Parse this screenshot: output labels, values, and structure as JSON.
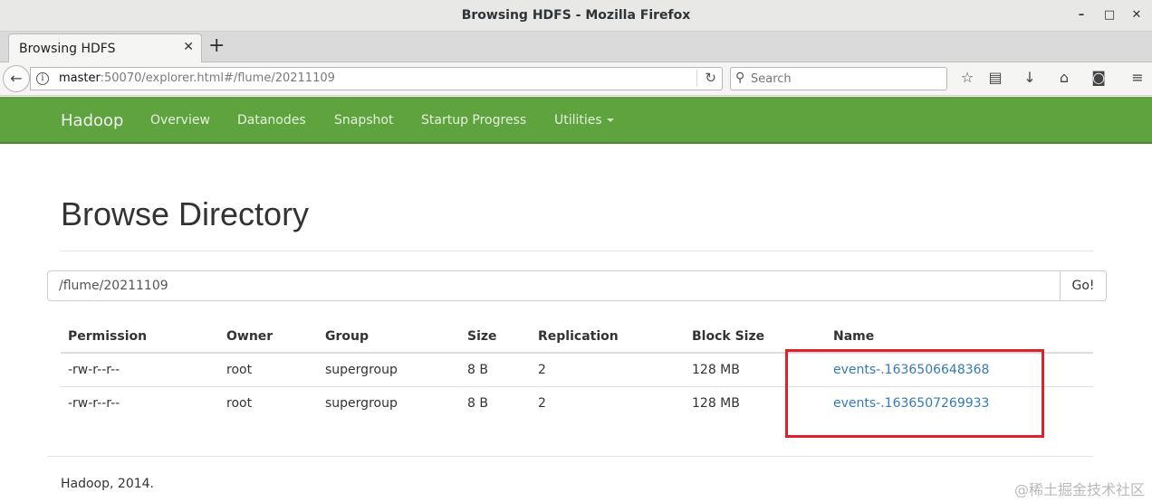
{
  "window": {
    "title": "Browsing HDFS - Mozilla Firefox"
  },
  "tabs": [
    {
      "label": "Browsing HDFS"
    }
  ],
  "address": {
    "host": "master",
    "path": ":50070/explorer.html#/flume/20211109"
  },
  "search": {
    "placeholder": "Search"
  },
  "hadoop_nav": {
    "brand": "Hadoop",
    "items": [
      "Overview",
      "Datanodes",
      "Snapshot",
      "Startup Progress",
      "Utilities"
    ]
  },
  "page": {
    "title": "Browse Directory",
    "path_value": "/flume/20211109",
    "go_label": "Go!"
  },
  "table": {
    "headers": [
      "Permission",
      "Owner",
      "Group",
      "Size",
      "Replication",
      "Block Size",
      "Name"
    ],
    "rows": [
      [
        "-rw-r--r--",
        "root",
        "supergroup",
        "8 B",
        "2",
        "128 MB",
        "events-.1636506648368"
      ],
      [
        "-rw-r--r--",
        "root",
        "supergroup",
        "8 B",
        "2",
        "128 MB",
        "events-.1636507269933"
      ]
    ]
  },
  "footer": "Hadoop, 2014.",
  "watermark": "@稀土掘金技术社区",
  "colors": {
    "navbar": "#5fa33e",
    "link": "#337ab7",
    "highlight": "#e0202a"
  }
}
